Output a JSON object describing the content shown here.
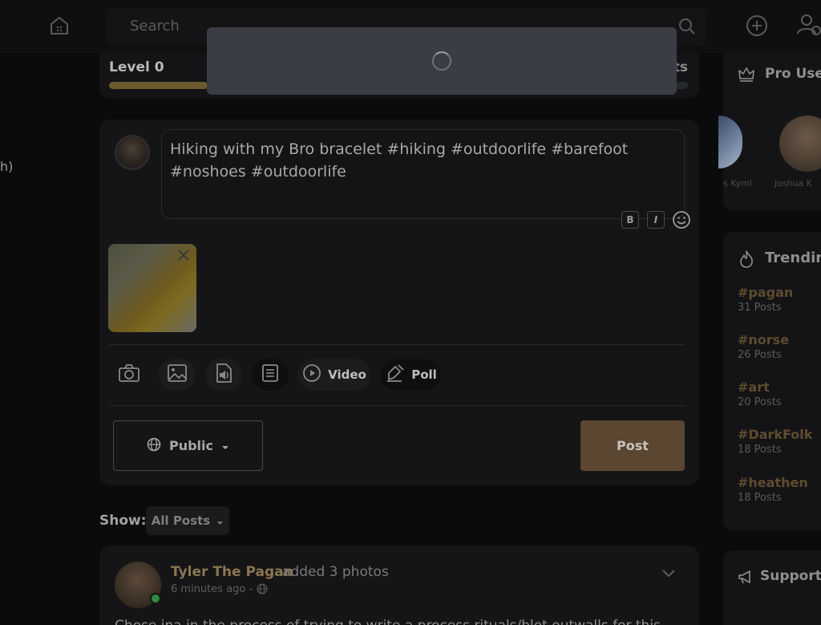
{
  "header": {
    "search_placeholder": "Search",
    "icons": [
      "home-icon",
      "search-icon",
      "add-circle-icon",
      "user-add-icon"
    ]
  },
  "left_fragment": "h)",
  "level": {
    "label": "Level 0",
    "right_label_fragment": "ts",
    "progress_fraction": 0.17
  },
  "composer": {
    "text": "Hiking with my Bro bracelet #hiking #outdoorlife #barefoot #noshoes #outdoorlife",
    "bold_label": "B",
    "italic_label": "I",
    "tools": {
      "video_label": "Video",
      "poll_label": "Poll"
    },
    "privacy_label": "Public",
    "post_label": "Post"
  },
  "feed_filter": {
    "show_label": "Show:",
    "selected": "All Posts"
  },
  "feed_post": {
    "author": "Tyler The Pagan",
    "action": "added 3 photos",
    "time": "6 minutes ago -",
    "text_fragment": "Chose ina in the process of trying to write a process rituals/blot outwalls for this"
  },
  "sidebar": {
    "pro_title": "Pro Use",
    "pro_users": [
      "s Kyml",
      "Joshua K"
    ],
    "trending_title": "Trendin",
    "trending": [
      {
        "tag": "#pagan",
        "count": "31 Posts"
      },
      {
        "tag": "#norse",
        "count": "26 Posts"
      },
      {
        "tag": "#art",
        "count": "20 Posts"
      },
      {
        "tag": "#DarkFolk",
        "count": "18 Posts"
      },
      {
        "tag": "#heathen",
        "count": "18 Posts"
      }
    ],
    "support_title": "Support"
  },
  "colors": {
    "accent_gold": "#5a4631",
    "tag_color": "#5f4b2f",
    "online": "#2f8a3f"
  }
}
